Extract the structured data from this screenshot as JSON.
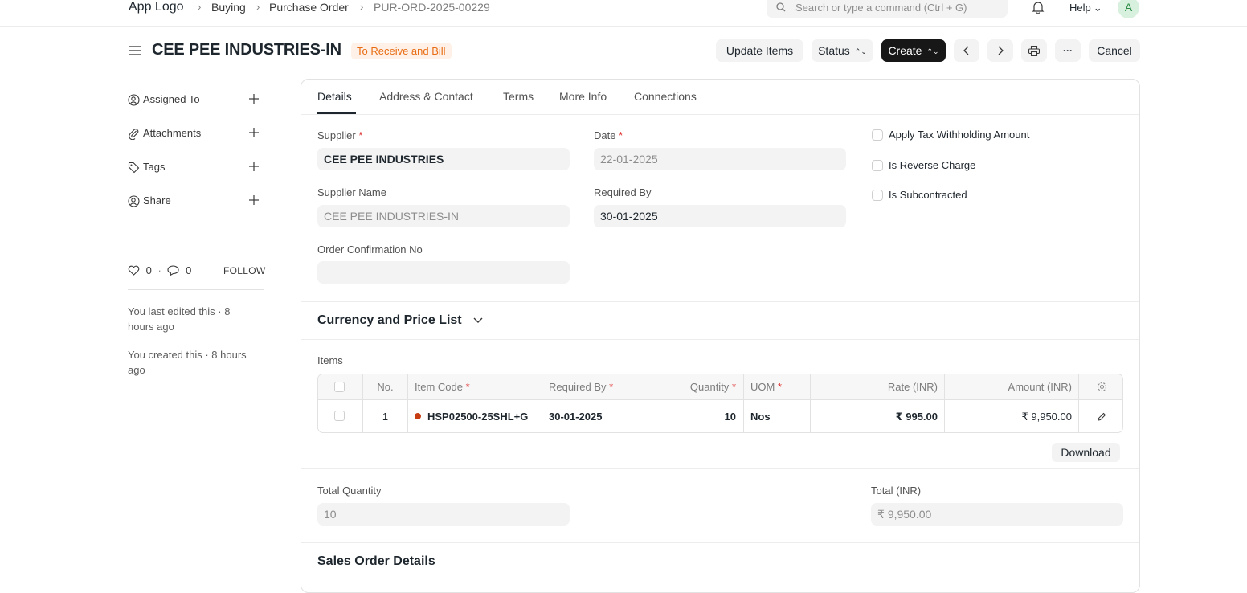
{
  "navbar": {
    "logo": "App Logo",
    "breadcrumbs": [
      "Buying",
      "Purchase Order",
      "PUR-ORD-2025-00229"
    ],
    "search_placeholder": "Search or type a command (Ctrl + G)",
    "help_label": "Help",
    "avatar_initial": "A"
  },
  "header": {
    "title": "CEE PEE INDUSTRIES-IN",
    "status": "To Receive and Bill",
    "buttons": {
      "update_items": "Update Items",
      "status": "Status",
      "create": "Create",
      "more": "···",
      "cancel": "Cancel"
    },
    "colors": {
      "status_bg": "#fff1e7",
      "status_text": "#e86c13",
      "primary": "#171717"
    }
  },
  "sidebar": {
    "items": [
      {
        "label": "Assigned To",
        "icon": "user-add-icon"
      },
      {
        "label": "Attachments",
        "icon": "paperclip-icon"
      },
      {
        "label": "Tags",
        "icon": "tag-icon"
      },
      {
        "label": "Share",
        "icon": "share-icon"
      }
    ],
    "likes": "0",
    "comments": "0",
    "follow": "FOLLOW",
    "activity": [
      "You last edited this · 8 hours ago",
      "You created this · 8 hours ago"
    ]
  },
  "tabs": [
    "Details",
    "Address & Contact",
    "Terms",
    "More Info",
    "Connections"
  ],
  "form": {
    "supplier_label": "Supplier",
    "supplier_value": "CEE PEE INDUSTRIES",
    "date_label": "Date",
    "date_value": "22-01-2025",
    "supplier_name_label": "Supplier Name",
    "supplier_name_value": "CEE PEE INDUSTRIES-IN",
    "required_by_label": "Required By",
    "required_by_value": "30-01-2025",
    "order_conf_label": "Order Confirmation No",
    "order_conf_value": "",
    "checkboxes": [
      "Apply Tax Withholding Amount",
      "Is Reverse Charge",
      "Is Subcontracted"
    ]
  },
  "currency_section": {
    "title": "Currency and Price List"
  },
  "items": {
    "label": "Items",
    "columns": [
      "No.",
      "Item Code",
      "Required By",
      "Quantity",
      "UOM",
      "Rate (INR)",
      "Amount (INR)"
    ],
    "rows": [
      {
        "no": "1",
        "item_code": "HSP02500-25SHL+G",
        "required_by": "30-01-2025",
        "quantity": "10",
        "uom": "Nos",
        "rate": "₹ 995.00",
        "amount": "₹ 9,950.00"
      }
    ],
    "download": "Download"
  },
  "totals": {
    "total_qty_label": "Total Quantity",
    "total_qty_value": "10",
    "total_label": "Total (INR)",
    "total_value": "₹ 9,950.00"
  },
  "sales_order_section": {
    "title": "Sales Order Details"
  }
}
